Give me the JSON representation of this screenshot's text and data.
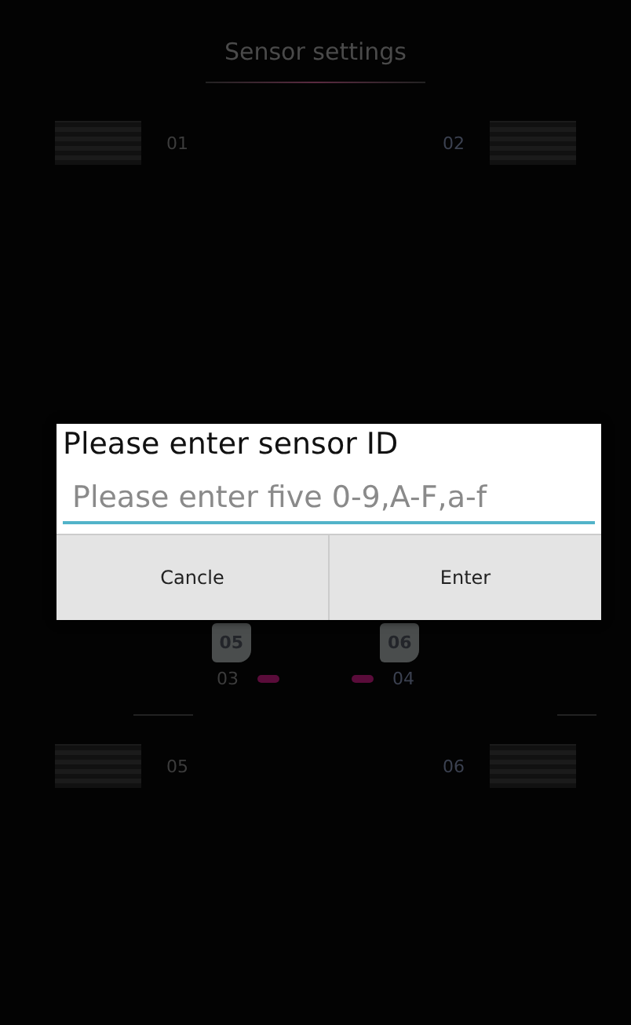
{
  "header": {
    "title": "Sensor settings"
  },
  "top_row": {
    "left_slot": "01",
    "right_slot": "02"
  },
  "car": {
    "rear_tags": [
      "05",
      "06"
    ],
    "mid_labels": [
      "03",
      "04"
    ]
  },
  "bottom_row": {
    "left_slot": "05",
    "right_slot": "06"
  },
  "dialog": {
    "title": "Please enter sensor ID",
    "input": {
      "placeholder": "Please enter five 0-9,A-F,a-f"
    },
    "buttons": [
      "Cancle",
      "Enter"
    ]
  }
}
